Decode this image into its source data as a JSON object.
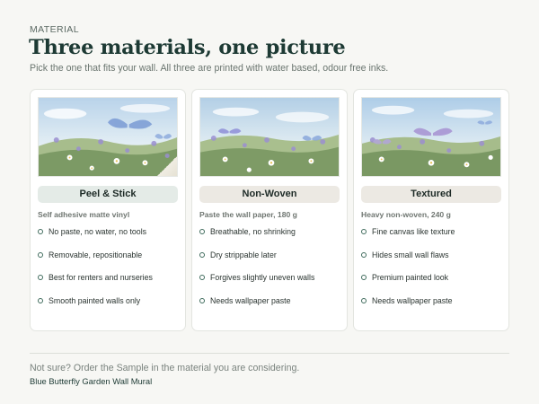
{
  "header": {
    "eyebrow": "MATERIAL",
    "title": "Three materials, one picture",
    "subtitle": "Pick the one that fits your wall. All three are printed with water based, odour free inks."
  },
  "cards": [
    {
      "name": "Peel & Stick",
      "spec": "Self adhesive matte vinyl",
      "features": [
        "No paste, no water, no tools",
        "Removable, repositionable",
        "Best for renters and nurseries",
        "Smooth painted walls only"
      ]
    },
    {
      "name": "Non-Woven",
      "spec": "Paste the wall paper, 180 g",
      "features": [
        "Breathable, no shrinking",
        "Dry strippable later",
        "Forgives slightly uneven walls",
        "Needs wallpaper paste"
      ]
    },
    {
      "name": "Textured",
      "spec": "Heavy non-woven, 240 g",
      "features": [
        "Fine canvas like texture",
        "Hides small wall flaws",
        "Premium painted look",
        "Needs wallpaper paste"
      ]
    }
  ],
  "footer": {
    "note": "Not sure? Order the Sample in the material you are considering.",
    "product": "Blue Butterfly Garden Wall Mural"
  },
  "colors": {
    "accent": "#1d3a34",
    "pill_selected": "#e4ebe7",
    "pill_default": "#ece9e3",
    "bullet": "#3f6b5c"
  },
  "icons": [
    "butterfly-icon",
    "bullet-ring-icon"
  ]
}
